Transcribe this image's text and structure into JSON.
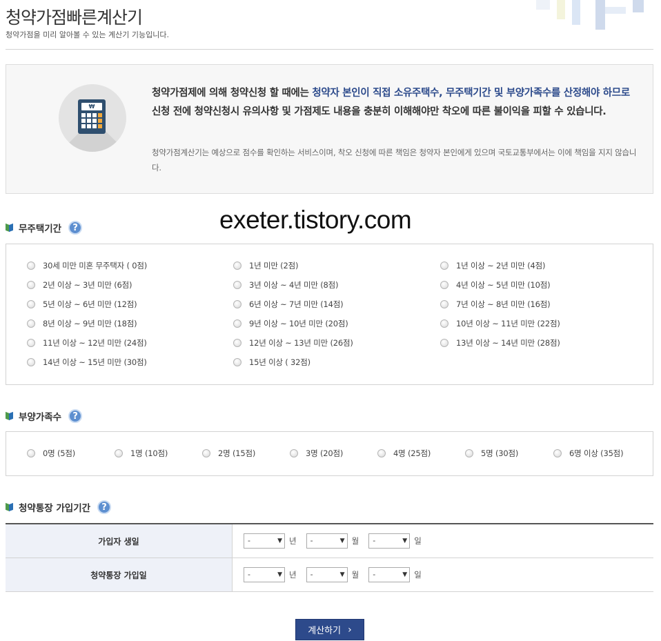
{
  "header": {
    "title": "청약가점빠른계산기",
    "subtitle": "청약가점을 미리 알아볼 수 있는 계산기 기능입니다."
  },
  "notice": {
    "main_part1": "청약가점제에 의해 청약신청 할 때에는 ",
    "main_highlight": "청약자 본인이 직접 소유주택수, 무주택기간 및 부양가족수를 산정해야 하므로",
    "main_part2": " 신청 전에 청약신청시 유의사항 및 가점제도 내용을 충분히 이해해야만 착오에 따른 불이익을 피할 수 있습니다.",
    "sub": "청약가점계산기는 예상으로 점수를 확인하는 서비스이며, 착오 신청에 따른 책임은 청약자 본인에게 있으며 국토교통부에서는 이에 책임을 지지 않습니다.",
    "icon_symbol": "₩"
  },
  "watermark": "exeter.tistory.com",
  "help_symbol": "?",
  "section_no_house": {
    "title": "무주택기간",
    "options": [
      "30세 미만 미혼 무주택자 ( 0점)",
      "1년 미만 (2점)",
      "1년 이상 ~ 2년 미만 (4점)",
      "2년 이상 ~ 3년 미만 (6점)",
      "3년 이상 ~ 4년 미만 (8점)",
      "4년 이상 ~ 5년 미만 (10점)",
      "5년 이상 ~ 6년 미만 (12점)",
      "6년 이상 ~ 7년 미만 (14점)",
      "7년 이상 ~ 8년 미만 (16점)",
      "8년 이상 ~ 9년 미만 (18점)",
      "9년 이상 ~ 10년 미만 (20점)",
      "10년 이상 ~ 11년 미만 (22점)",
      "11년 이상 ~ 12년 미만 (24점)",
      "12년 이상 ~ 13년 미만 (26점)",
      "13년 이상 ~ 14년 미만 (28점)",
      "14년 이상 ~ 15년 미만 (30점)",
      "15년 이상 ( 32점)"
    ]
  },
  "section_dependents": {
    "title": "부양가족수",
    "options": [
      "0명 (5점)",
      "1명 (10점)",
      "2명 (15점)",
      "3명 (20점)",
      "4명 (25점)",
      "5명 (30점)",
      "6명 이상 (35점)"
    ]
  },
  "section_account": {
    "title": "청약통장 가입기간",
    "rows": [
      {
        "label": "가입자 생일",
        "year": "-",
        "month": "-",
        "day": "-"
      },
      {
        "label": "청약통장 가입일",
        "year": "-",
        "month": "-",
        "day": "-"
      }
    ],
    "unit_year": "년",
    "unit_month": "월",
    "unit_day": "일"
  },
  "calc_button": {
    "label": "계산하기",
    "icon": "chevron-right-icon"
  },
  "colors": {
    "accent": "#2d4a8b",
    "highlight_text": "#2c4a8b",
    "help_icon": "#5d8fd0",
    "table_header_bg": "#eef1f8"
  }
}
